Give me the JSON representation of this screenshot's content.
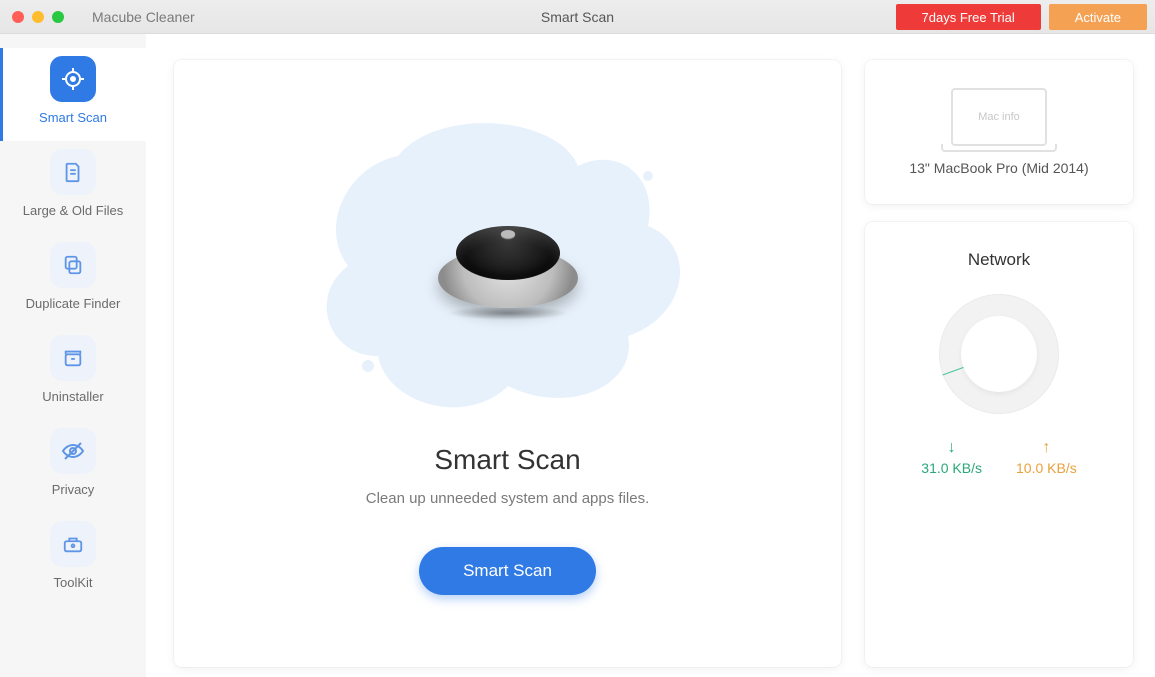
{
  "header": {
    "app_name": "Macube Cleaner",
    "title": "Smart Scan",
    "trial_label": "7days Free Trial",
    "activate_label": "Activate"
  },
  "sidebar": {
    "items": [
      {
        "id": "smart-scan",
        "label": "Smart Scan",
        "icon": "target-icon"
      },
      {
        "id": "large-old",
        "label": "Large & Old Files",
        "icon": "file-icon"
      },
      {
        "id": "duplicate",
        "label": "Duplicate Finder",
        "icon": "copy-icon"
      },
      {
        "id": "uninstaller",
        "label": "Uninstaller",
        "icon": "archive-icon"
      },
      {
        "id": "privacy",
        "label": "Privacy",
        "icon": "eye-off-icon"
      },
      {
        "id": "toolkit",
        "label": "ToolKit",
        "icon": "toolbox-icon"
      }
    ],
    "active_index": 0
  },
  "main": {
    "title": "Smart Scan",
    "subtitle": "Clean up unneeded system and apps files.",
    "scan_button": "Smart Scan"
  },
  "info_panel": {
    "illustration_text": "Mac info",
    "device": "13\" MacBook Pro (Mid 2014)"
  },
  "network_panel": {
    "title": "Network",
    "download": "31.0 KB/s",
    "upload": "10.0 KB/s"
  }
}
